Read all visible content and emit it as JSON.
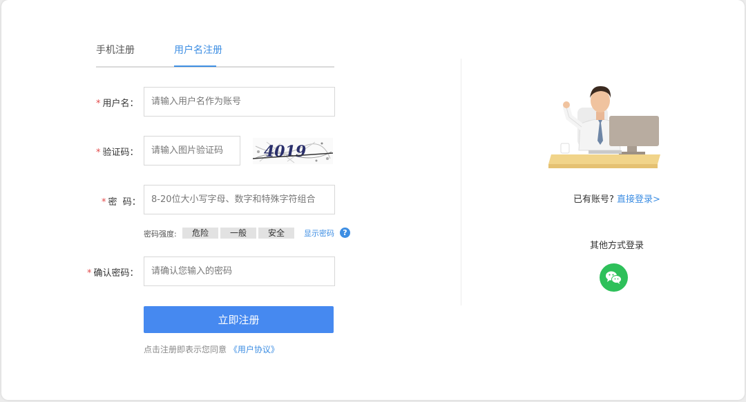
{
  "tabs": {
    "phone": "手机注册",
    "username": "用户名注册"
  },
  "form": {
    "username_label": "用户名：",
    "username_placeholder": "请输入用户名作为账号",
    "captcha_label": "验证码：",
    "captcha_placeholder": "请输入图片验证码",
    "captcha_text": "4019",
    "password_label": "密  码：",
    "password_placeholder": "8-20位大小写字母、数字和特殊字符组合",
    "confirm_label": "确认密码：",
    "confirm_placeholder": "请确认您输入的密码",
    "required_mark": "*"
  },
  "strength": {
    "label": "密码强度:",
    "levels": [
      "危险",
      "一般",
      "安全"
    ],
    "show_password": "显示密码",
    "help": "?"
  },
  "submit": "立即注册",
  "agreement": {
    "text": "点击注册即表示您同意",
    "link": "《用户协议》"
  },
  "login": {
    "text": "已有账号?",
    "link": "直接登录>"
  },
  "other_login": "其他方式登录",
  "colors": {
    "accent": "#3d8ee3",
    "button": "#4689f0",
    "required": "#e24a4a",
    "wechat": "#2ec05a"
  }
}
